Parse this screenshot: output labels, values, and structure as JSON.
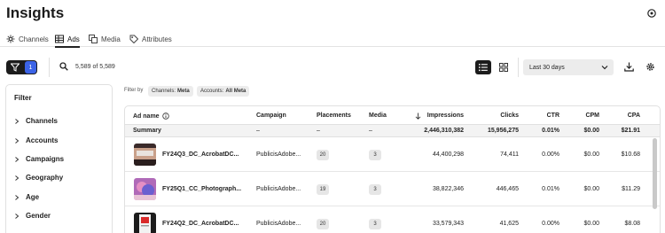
{
  "page": {
    "title": "Insights"
  },
  "tabs": [
    {
      "label": "Channels",
      "icon": "channels-icon"
    },
    {
      "label": "Ads",
      "icon": "ads-icon",
      "active": true
    },
    {
      "label": "Media",
      "icon": "media-icon"
    },
    {
      "label": "Attributes",
      "icon": "tag-icon"
    }
  ],
  "toolbar": {
    "filter_count": "1",
    "result_count": "5,589 of 5,589",
    "date_range": "Last 30 days"
  },
  "filter_panel": {
    "heading": "Filter",
    "items": [
      "Channels",
      "Accounts",
      "Campaigns",
      "Geography",
      "Age",
      "Gender"
    ]
  },
  "filter_by": {
    "label": "Filter by",
    "chips": [
      {
        "key": "Channels:",
        "value": "Meta"
      },
      {
        "key": "Accounts:",
        "value": "All Meta"
      }
    ]
  },
  "table": {
    "columns": [
      "Ad name",
      "Campaign",
      "Placements",
      "Media",
      "Impressions",
      "Clicks",
      "CTR",
      "CPM",
      "CPA"
    ],
    "summary": {
      "label": "Summary",
      "campaign": "–",
      "placements": "–",
      "media": "–",
      "impressions": "2,446,310,382",
      "clicks": "15,956,275",
      "ctr": "0.01%",
      "cpm": "$0.00",
      "cpa": "$21.91"
    },
    "rows": [
      {
        "ad_name": "FY24Q3_DC_AcrobatDC...",
        "campaign": "PublicisAdobe...",
        "placements": "20",
        "media": "3",
        "impressions": "44,400,298",
        "clicks": "74,411",
        "ctr": "0.00%",
        "cpm": "$0.00",
        "cpa": "$10.68"
      },
      {
        "ad_name": "FY25Q1_CC_Photograph...",
        "campaign": "PublicisAdobe...",
        "placements": "19",
        "media": "3",
        "impressions": "38,822,346",
        "clicks": "446,465",
        "ctr": "0.01%",
        "cpm": "$0.00",
        "cpa": "$11.29"
      },
      {
        "ad_name": "FY24Q2_DC_AcrobatDC...",
        "campaign": "PublicisAdobe...",
        "placements": "20",
        "media": "3",
        "impressions": "33,579,343",
        "clicks": "41,625",
        "ctr": "0.00%",
        "cpm": "$0.00",
        "cpa": "$8.08"
      }
    ]
  },
  "colors": {
    "accent": "#3b63e6",
    "dark": "#1c1c1c",
    "chip_bg": "#ececec"
  }
}
